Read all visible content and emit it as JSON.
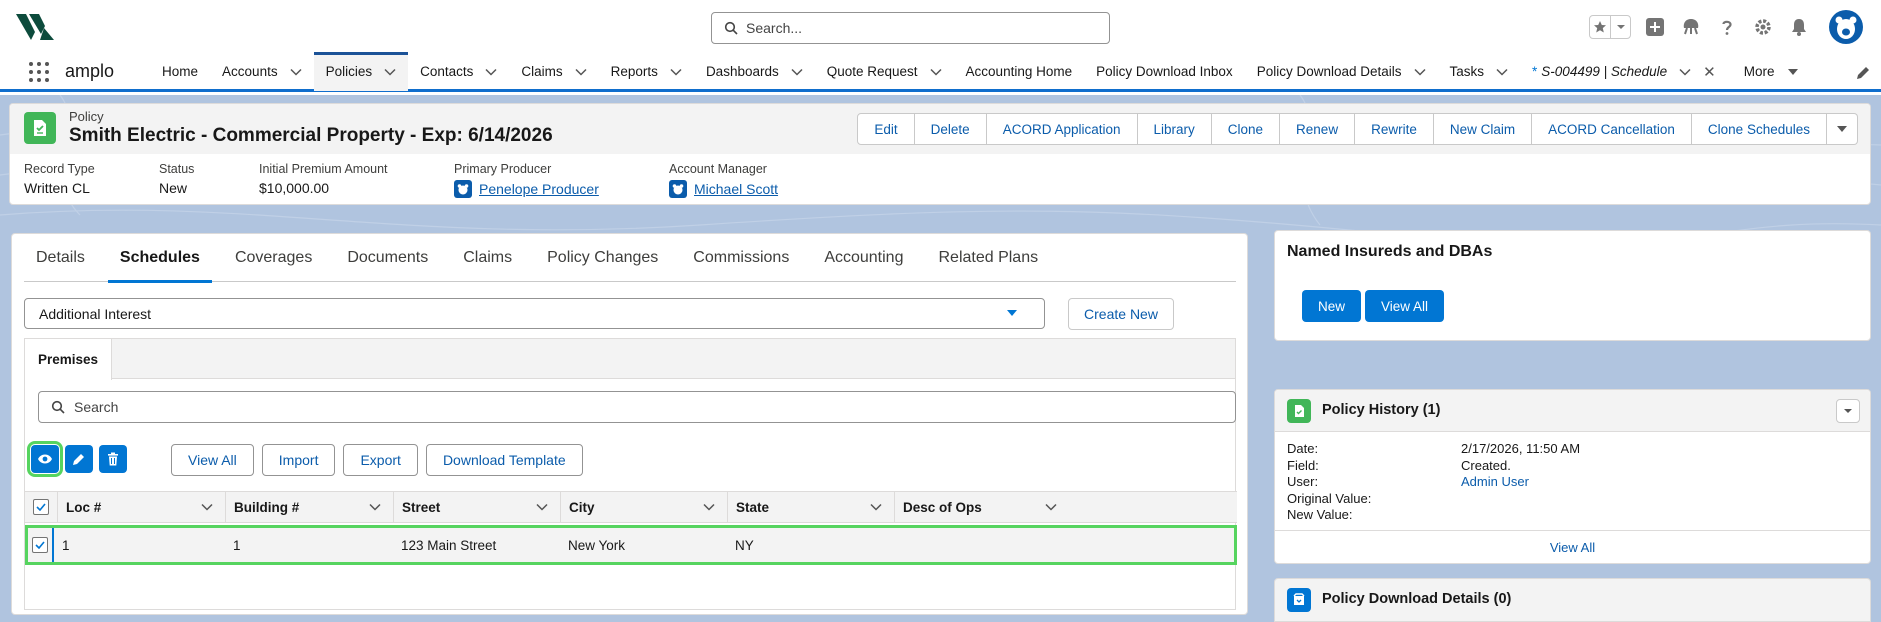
{
  "header": {
    "search_placeholder": "Search...",
    "icons": [
      "favorites-star-icon",
      "chevron-down-icon",
      "add-icon",
      "trailhead-icon",
      "help-icon",
      "setup-gear-icon",
      "notification-bell-icon",
      "user-avatar"
    ]
  },
  "nav": {
    "app_name": "amplo",
    "items": [
      {
        "label": "Home",
        "dropdown": false
      },
      {
        "label": "Accounts",
        "dropdown": true
      },
      {
        "label": "Policies",
        "dropdown": true,
        "active": true
      },
      {
        "label": "Contacts",
        "dropdown": true
      },
      {
        "label": "Claims",
        "dropdown": true
      },
      {
        "label": "Reports",
        "dropdown": true
      },
      {
        "label": "Dashboards",
        "dropdown": true
      },
      {
        "label": "Quote Request",
        "dropdown": true
      },
      {
        "label": "Accounting Home",
        "dropdown": false
      },
      {
        "label": "Policy Download Inbox",
        "dropdown": false
      },
      {
        "label": "Policy Download Details",
        "dropdown": true
      },
      {
        "label": "Tasks",
        "dropdown": true
      }
    ],
    "workspace_tab": {
      "marker": "*",
      "label": "S-004499 | Schedule"
    },
    "more_label": "More"
  },
  "record": {
    "object_label": "Policy",
    "title": "Smith Electric - Commercial Property - Exp: 6/14/2026",
    "actions": [
      "Edit",
      "Delete",
      "ACORD Application",
      "Library",
      "Clone",
      "Renew",
      "Rewrite",
      "New Claim",
      "ACORD Cancellation",
      "Clone Schedules"
    ],
    "fields": {
      "record_type": {
        "label": "Record Type",
        "value": "Written CL"
      },
      "status": {
        "label": "Status",
        "value": "New"
      },
      "premium": {
        "label": "Initial Premium Amount",
        "value": "$10,000.00"
      },
      "producer": {
        "label": "Primary Producer",
        "value": "Penelope Producer"
      },
      "manager": {
        "label": "Account Manager",
        "value": "Michael Scott"
      }
    }
  },
  "tabs": [
    "Details",
    "Schedules",
    "Coverages",
    "Documents",
    "Claims",
    "Policy Changes",
    "Commissions",
    "Accounting",
    "Related Plans"
  ],
  "active_tab": "Schedules",
  "schedules": {
    "selected_type": "Additional Interest",
    "create_new_label": "Create New",
    "subtab": "Premises",
    "search_placeholder": "Search",
    "buttons": [
      "View All",
      "Import",
      "Export",
      "Download Template"
    ],
    "columns": [
      "Loc #",
      "Building #",
      "Street",
      "City",
      "State",
      "Desc of Ops"
    ],
    "rows": [
      {
        "checked": true,
        "loc": "1",
        "building": "1",
        "street": "123 Main Street",
        "city": "New York",
        "state": "NY",
        "desc": ""
      }
    ]
  },
  "named_insureds": {
    "title": "Named Insureds and DBAs",
    "new_label": "New",
    "view_all_label": "View All"
  },
  "policy_history": {
    "title": "Policy History (1)",
    "field_labels": [
      "Date:",
      "Field:",
      "User:",
      "Original Value:",
      "New Value:"
    ],
    "values": {
      "date": "2/17/2026, 11:50 AM",
      "field": "Created.",
      "user": "Admin User",
      "original": "",
      "new": ""
    },
    "view_all_label": "View All"
  },
  "policy_download": {
    "title": "Policy Download Details (0)"
  },
  "colors": {
    "brand_blue": "#0176d3",
    "link_blue": "#0b5cab",
    "highlight_green": "#56d45f",
    "policy_icon_green": "#41b658",
    "background": "#b0c4df"
  }
}
